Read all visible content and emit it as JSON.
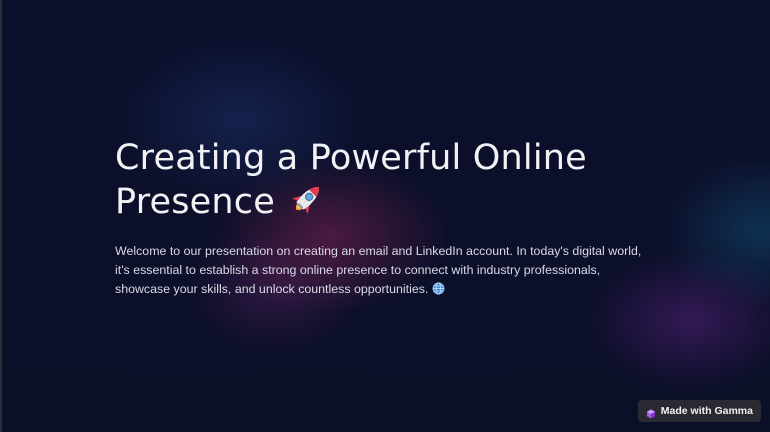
{
  "slide": {
    "title": "Creating a Powerful Online Presence",
    "title_icon": "rocket-icon",
    "body": "Welcome to our presentation on creating an email and LinkedIn account. In today's digital world, it's essential to establish a strong online presence to connect with industry professionals, showcase your skills, and unlock countless opportunities.",
    "body_icon": "globe-icon"
  },
  "badge": {
    "label": "Made with Gamma",
    "icon": "gamma-logo-icon"
  },
  "colors": {
    "background": "#0c0f2a",
    "title_text": "#f2f2f6",
    "body_text": "#d9dbe6",
    "badge_bg": "#2a2a33"
  }
}
